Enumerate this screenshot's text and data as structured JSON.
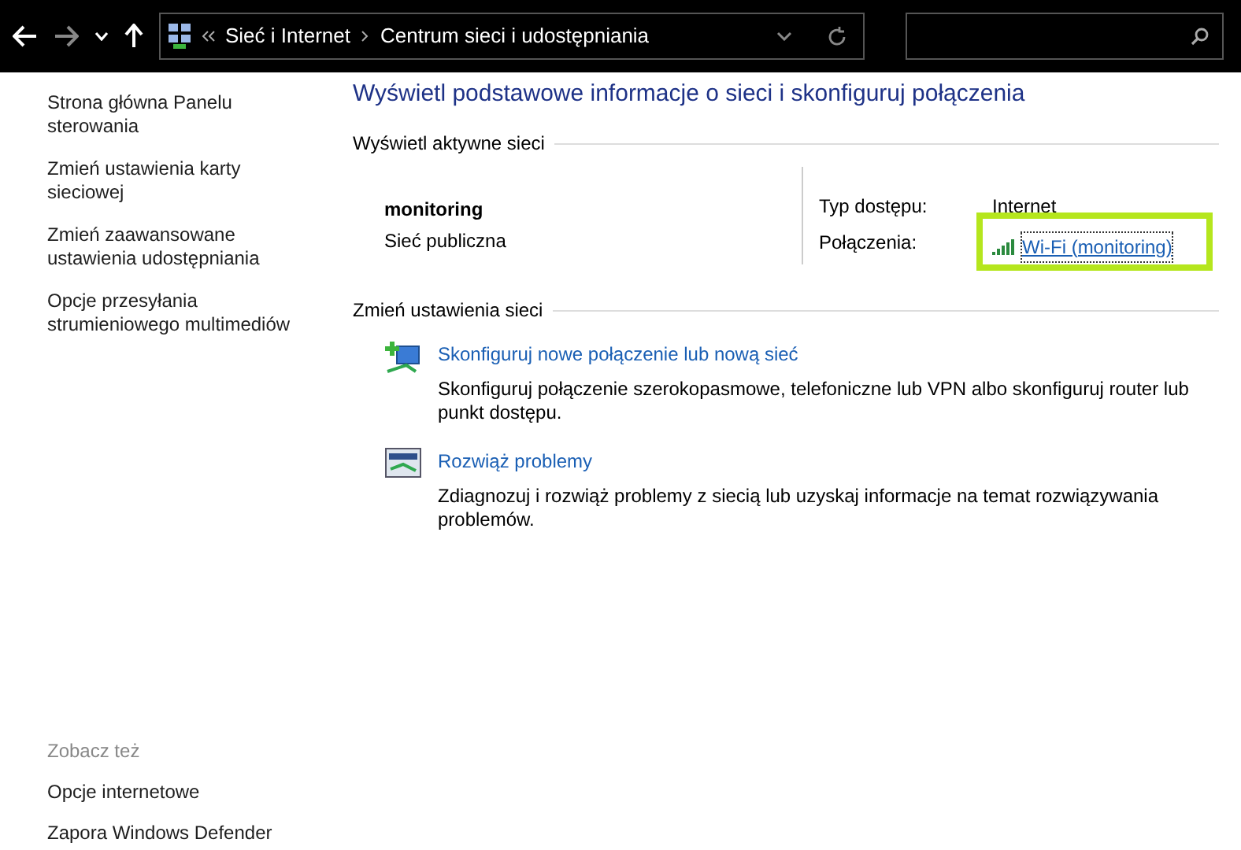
{
  "toolbar": {
    "breadcrumbs": [
      "Sieć i Internet",
      "Centrum sieci i udostępniania"
    ]
  },
  "sidebar": {
    "items": [
      {
        "label": "Strona główna Panelu sterowania"
      },
      {
        "label": "Zmień ustawienia karty sieciowej"
      },
      {
        "label": "Zmień zaawansowane ustawienia udostępniania"
      },
      {
        "label": "Opcje przesyłania strumieniowego multimediów"
      }
    ],
    "see_also": {
      "heading": "Zobacz też",
      "items": [
        "Opcje internetowe",
        "Zapora Windows Defender"
      ]
    }
  },
  "main": {
    "title": "Wyświetl podstawowe informacje o sieci i skonfiguruj połączenia",
    "active_networks": {
      "heading": "Wyświetl aktywne sieci",
      "name": "monitoring",
      "category": "Sieć publiczna",
      "access_label": "Typ dostępu:",
      "access_value": "Internet",
      "connections_label": "Połączenia:",
      "connection_link": "Wi-Fi (monitoring)",
      "highlighted": true
    },
    "change_settings": {
      "heading": "Zmień ustawienia sieci",
      "tasks": [
        {
          "kind": "new-connection",
          "link": "Skonfiguruj nowe połączenie lub nową sieć",
          "description": "Skonfiguruj połączenie szerokopasmowe, telefoniczne lub VPN albo skonfiguruj router lub punkt dostępu."
        },
        {
          "kind": "troubleshoot",
          "link": "Rozwiąż problemy",
          "description": "Zdiagnozuj i rozwiąż problemy z siecią lub uzyskaj informacje na temat rozwiązywania problemów."
        }
      ]
    }
  }
}
